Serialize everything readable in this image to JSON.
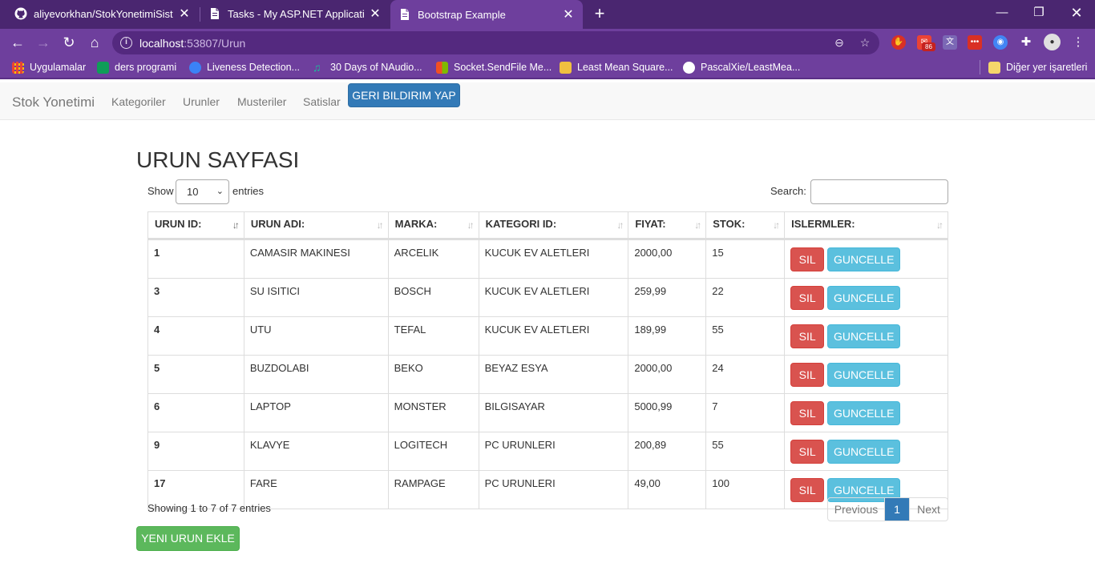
{
  "browser": {
    "tabs": [
      {
        "title": "aliyevorkhan/StokYonetimiSistemi",
        "icon": "github-icon"
      },
      {
        "title": "Tasks - My ASP.NET Application",
        "icon": "page-icon"
      },
      {
        "title": "Bootstrap Example",
        "icon": "page-icon",
        "active": true
      }
    ],
    "address": {
      "host": "localhost",
      "path": ":53807/Urun"
    },
    "extensions": {
      "mail_badge": "86"
    },
    "bookmarks": [
      {
        "label": "Uygulamalar",
        "color": "#e8a33d"
      },
      {
        "label": "ders programi",
        "color": "#0f9d58"
      },
      {
        "label": "Liveness Detection...",
        "color": "#3b82f6"
      },
      {
        "label": "30 Days of NAudio...",
        "color": "#1abc9c"
      },
      {
        "label": "Socket.SendFile Me...",
        "color": "#f25022"
      },
      {
        "label": "Least Mean Square...",
        "color": "#c0392b"
      },
      {
        "label": "PascalXie/LeastMea...",
        "color": "#ffffff"
      }
    ],
    "other_bookmarks": "Diğer yer işaretleri"
  },
  "navbar": {
    "brand": "Stok Yonetimi",
    "links": [
      "Kategoriler",
      "Urunler",
      "Musteriler",
      "Satislar"
    ],
    "feedback_button": "GERI BILDIRIM YAP"
  },
  "page": {
    "title": "URUN SAYFASI",
    "show_label": "Show",
    "length_value": "10",
    "entries_label": "entries",
    "search_label": "Search:",
    "search_value": ""
  },
  "table": {
    "columns": [
      "URUN ID:",
      "URUN ADI:",
      "MARKA:",
      "KATEGORI ID:",
      "FIYAT:",
      "STOK:",
      "ISLERMLER:"
    ],
    "rows": [
      {
        "id": "1",
        "name": "CAMASIR MAKINESI",
        "brand": "ARCELIK",
        "category": "KUCUK EV ALETLERI",
        "price": "2000,00",
        "stock": "15"
      },
      {
        "id": "3",
        "name": "SU ISITICI",
        "brand": "BOSCH",
        "category": "KUCUK EV ALETLERI",
        "price": "259,99",
        "stock": "22"
      },
      {
        "id": "4",
        "name": "UTU",
        "brand": "TEFAL",
        "category": "KUCUK EV ALETLERI",
        "price": "189,99",
        "stock": "55"
      },
      {
        "id": "5",
        "name": "BUZDOLABI",
        "brand": "BEKO",
        "category": "BEYAZ ESYA",
        "price": "2000,00",
        "stock": "24"
      },
      {
        "id": "6",
        "name": "LAPTOP",
        "brand": "MONSTER",
        "category": "BILGISAYAR",
        "price": "5000,99",
        "stock": "7"
      },
      {
        "id": "9",
        "name": "KLAVYE",
        "brand": "LOGITECH",
        "category": "PC URUNLERI",
        "price": "200,89",
        "stock": "55"
      },
      {
        "id": "17",
        "name": "FARE",
        "brand": "RAMPAGE",
        "category": "PC URUNLERI",
        "price": "49,00",
        "stock": "100"
      }
    ],
    "delete_label": "SIL",
    "update_label": "GUNCELLE"
  },
  "footer": {
    "info": "Showing 1 to 7 of 7 entries",
    "prev": "Previous",
    "current_page": "1",
    "next": "Next",
    "add_button": "YENI URUN EKLE"
  }
}
